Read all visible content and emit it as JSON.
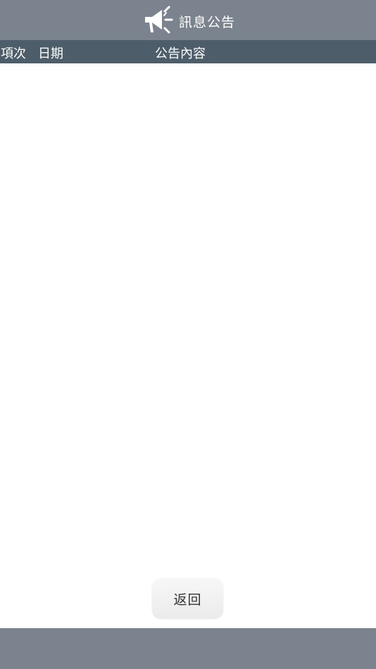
{
  "topbar": {
    "title": "訊息公告",
    "icon": "megaphone-icon"
  },
  "table": {
    "columns": [
      "項次",
      "日期",
      "公告內容"
    ],
    "rows": []
  },
  "actions": {
    "back_label": "返回"
  },
  "colors": {
    "topbar_bg": "#7a838e",
    "header_bg": "#4d5d6a",
    "footer_bg": "#7a838e",
    "button_bg": "#f0f0f0"
  }
}
